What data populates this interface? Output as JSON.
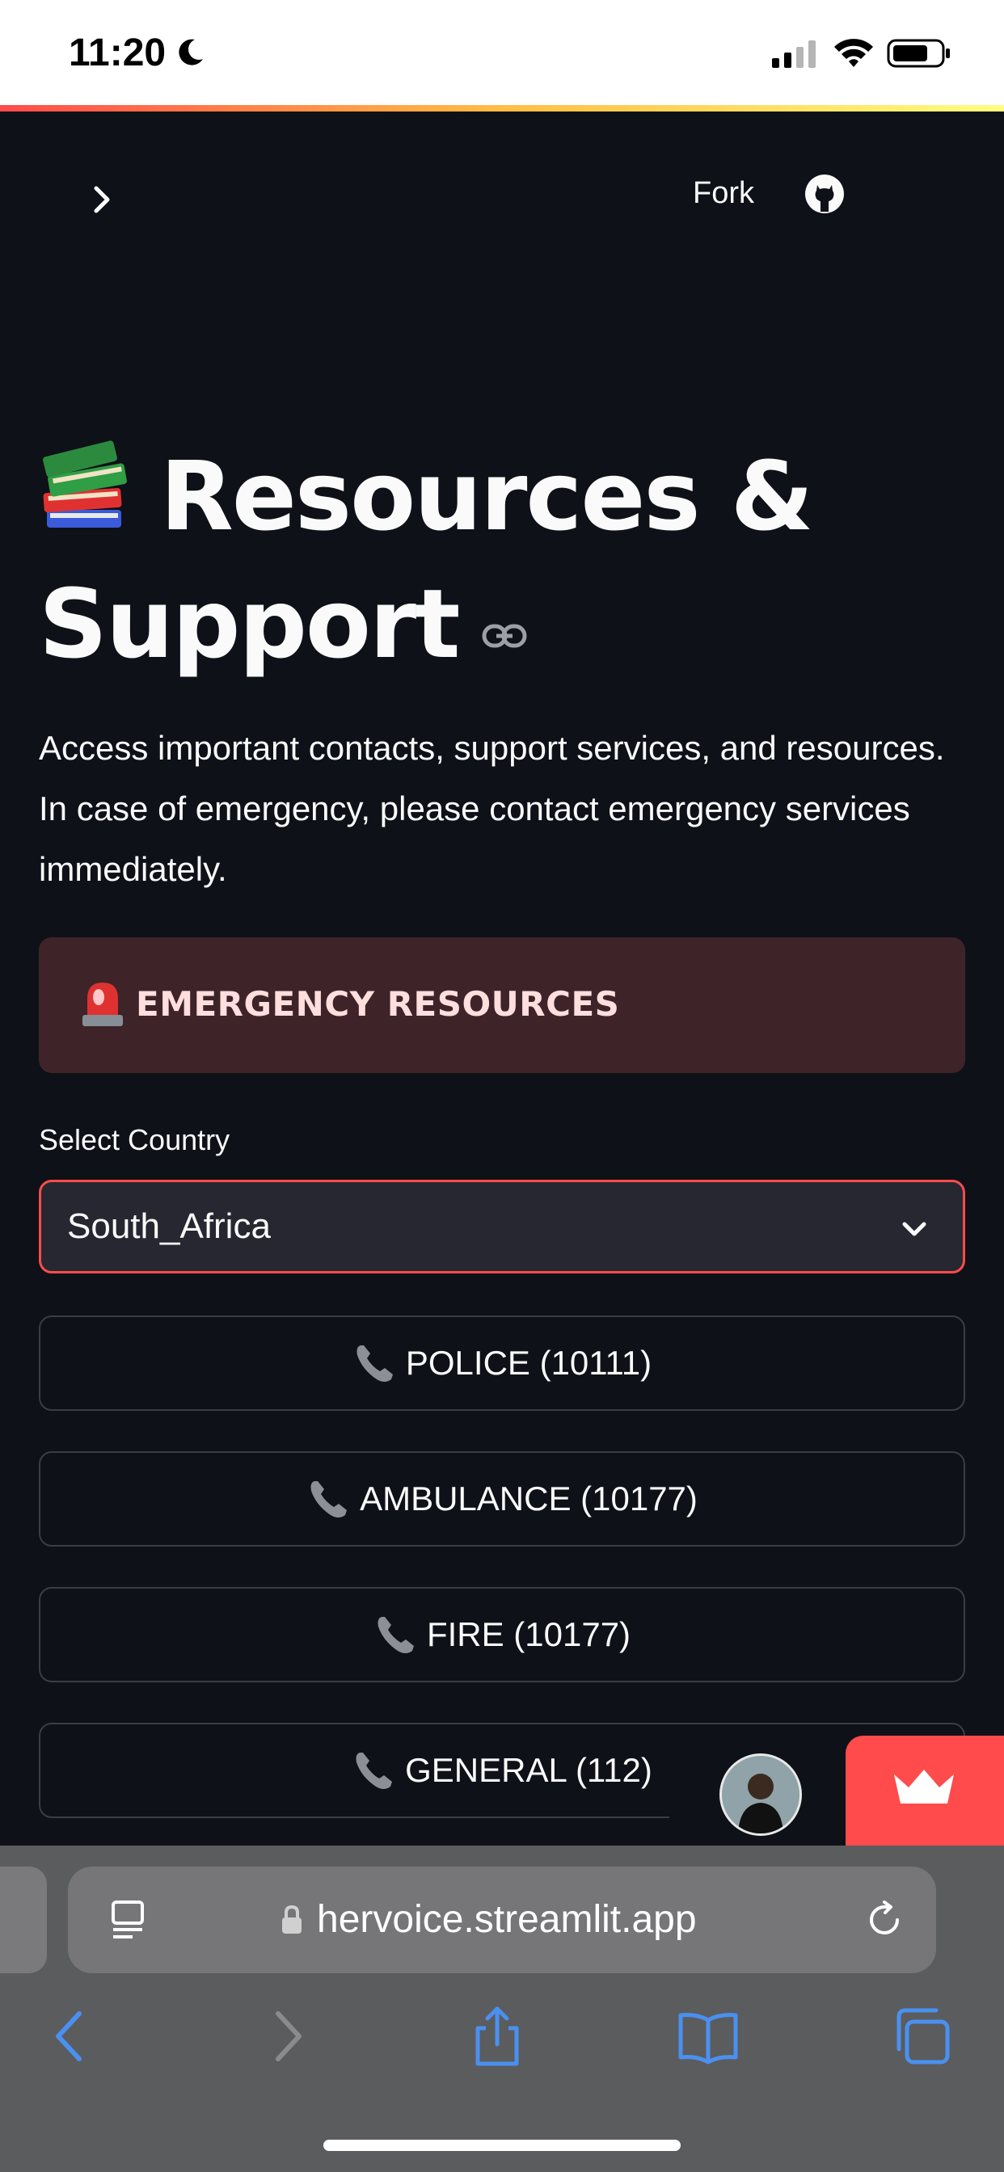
{
  "status_bar": {
    "time": "11:20"
  },
  "header": {
    "fork_label": "Fork"
  },
  "page": {
    "title": "Resources & Support",
    "intro": "Access important contacts, support services, and resources. In case of emergency, please contact emergency services immediately."
  },
  "alert": {
    "text": "EMERGENCY RESOURCES"
  },
  "country_select": {
    "label": "Select Country",
    "value": "South_Africa"
  },
  "contacts": [
    {
      "label": "POLICE (10111)"
    },
    {
      "label": "AMBULANCE (10177)"
    },
    {
      "label": "FIRE (10177)"
    },
    {
      "label": "GENERAL (112)"
    }
  ],
  "browser": {
    "url": "hervoice.streamlit.app"
  },
  "colors": {
    "background": "#0e1117",
    "accent": "#ff4b4b",
    "alert_bg": "#3e2428",
    "safari_bar": "#5b5c5e",
    "ios_blue": "#3b82f6"
  }
}
